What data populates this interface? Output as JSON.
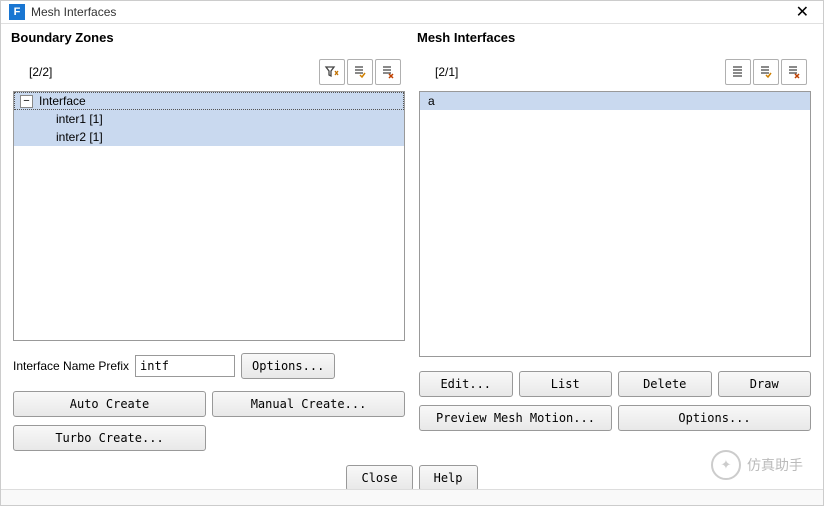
{
  "titlebar": {
    "title": "Mesh Interfaces",
    "icon_letter": "F"
  },
  "left": {
    "title": "Boundary Zones",
    "counter": "[2/2]",
    "tree": {
      "root": "Interface",
      "children": [
        {
          "label": "inter1  [1]"
        },
        {
          "label": "inter2  [1]"
        }
      ]
    },
    "prefix_label": "Interface Name Prefix",
    "prefix_value": "intf",
    "options_btn": "Options...",
    "auto_create": "Auto Create",
    "manual_create": "Manual Create...",
    "turbo_create": "Turbo Create..."
  },
  "right": {
    "title": "Mesh Interfaces",
    "counter": "[2/1]",
    "items": [
      {
        "label": "a"
      }
    ],
    "edit": "Edit...",
    "list": "List",
    "delete": "Delete",
    "draw": "Draw",
    "preview": "Preview Mesh Motion...",
    "options": "Options..."
  },
  "bottom": {
    "close": "Close",
    "help": "Help"
  },
  "watermark": {
    "text": "仿真助手"
  }
}
